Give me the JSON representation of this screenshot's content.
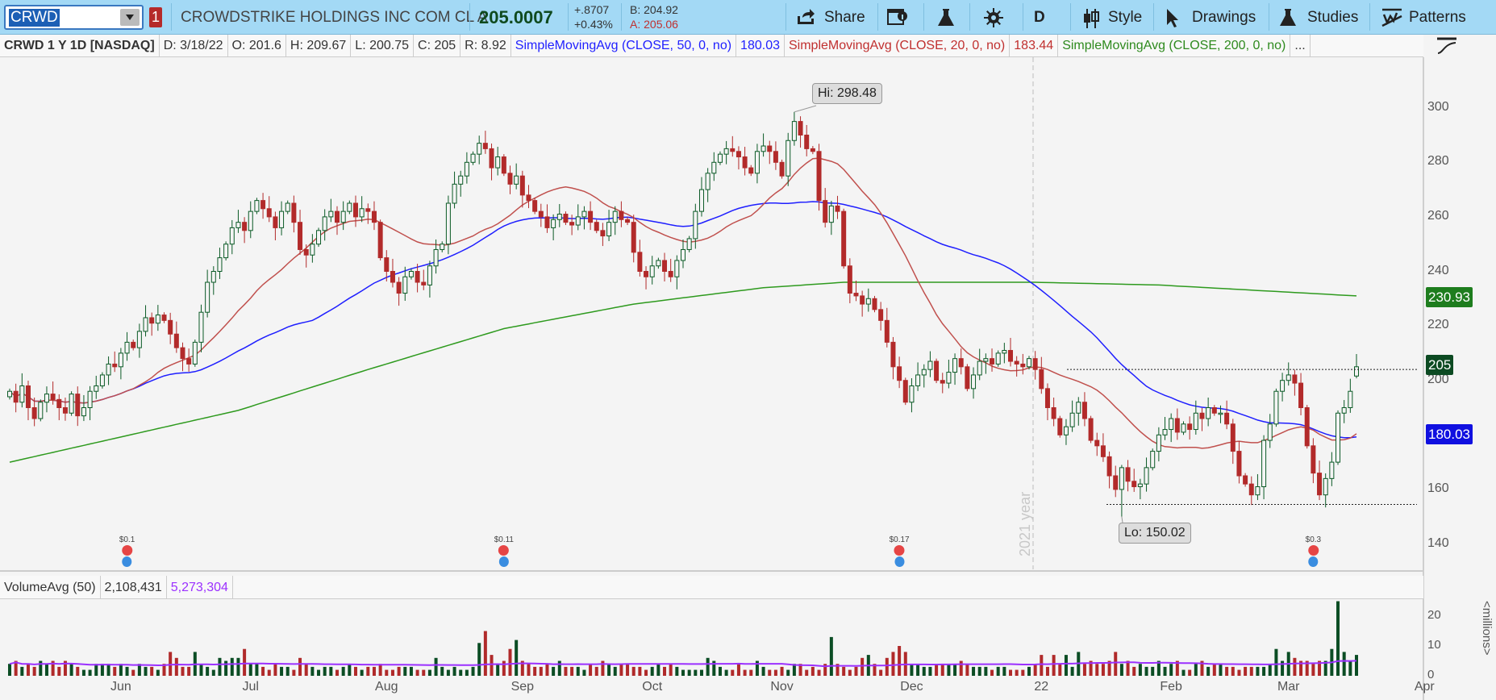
{
  "toolbar": {
    "symbol": "CRWD",
    "link_badge": "1",
    "company": "CROWDSTRIKE HOLDINGS INC COM CL A",
    "last": "205.0007",
    "change": "+.8707",
    "change_pct": "+0.43%",
    "bid": "B: 204.92",
    "ask": "A: 205.06",
    "share": "Share",
    "period": "D",
    "style": "Style",
    "drawings": "Drawings",
    "studies": "Studies",
    "patterns": "Patterns"
  },
  "legend": {
    "title": "CRWD 1 Y 1D [NASDAQ]",
    "date": "D: 3/18/22",
    "open": "O: 201.6",
    "high": "H: 209.67",
    "low": "L: 200.75",
    "close": "C: 205",
    "range": "R: 8.92",
    "sma50_label": "SimpleMovingAvg (CLOSE, 50, 0, no)",
    "sma50_value": "180.03",
    "sma20_label": "SimpleMovingAvg (CLOSE, 20, 0, no)",
    "sma20_value": "183.44",
    "sma200_label": "SimpleMovingAvg (CLOSE, 200, 0, no)",
    "more": "..."
  },
  "volume": {
    "title": "VolumeAvg (50)",
    "value": "2,108,431",
    "avg": "5,273,304",
    "unit_label": "<millions>"
  },
  "annotations": {
    "hi": "Hi: 298.48",
    "lo": "Lo: 150.02",
    "year_marker": "2021 year",
    "resistance": 204,
    "support": 154.5
  },
  "badges": {
    "sma200": "230.93",
    "last": "205",
    "sma50": "180.03"
  },
  "events": [
    {
      "label": "$0.1",
      "index": 19
    },
    {
      "label": "$0.11",
      "index": 80
    },
    {
      "label": "$0.17",
      "index": 144
    },
    {
      "label": "$0.3",
      "index": 211
    }
  ],
  "colors": {
    "up": "#0b5a26",
    "down": "#b22a2a",
    "sma20": "#c0504d",
    "sma50": "#1f1fff",
    "sma200": "#2e9a1e",
    "volavg": "#9b30ff",
    "sma200_badge": "#1e7d1e",
    "last_badge": "#0c4a22",
    "sma50_badge": "#1010e0"
  },
  "chart_data": {
    "type": "candlestick",
    "title": "CRWD 1 Y 1D [NASDAQ]",
    "ylim": [
      130,
      310
    ],
    "y_ticks": [
      140,
      160,
      180,
      200,
      220,
      240,
      260,
      280,
      300
    ],
    "x_ticks": [
      {
        "label": "Jun",
        "index": 18
      },
      {
        "label": "Jul",
        "index": 39
      },
      {
        "label": "Aug",
        "index": 61
      },
      {
        "label": "Sep",
        "index": 83
      },
      {
        "label": "Oct",
        "index": 104
      },
      {
        "label": "Nov",
        "index": 125
      },
      {
        "label": "Dec",
        "index": 146
      },
      {
        "label": "22",
        "index": 167
      },
      {
        "label": "Feb",
        "index": 188
      },
      {
        "label": "Mar",
        "index": 207
      },
      {
        "label": "Apr",
        "index": 229
      }
    ],
    "last_bar": {
      "open": 201.6,
      "high": 209.67,
      "low": 200.75,
      "close": 205
    },
    "hi": {
      "value": 298.48,
      "index": 127
    },
    "lo": {
      "value": 150.02,
      "index": 180
    },
    "close": [
      196,
      192,
      198,
      190,
      186,
      192,
      195,
      193,
      190,
      188,
      195,
      187,
      190,
      196,
      198,
      202,
      206,
      205,
      210,
      214,
      212,
      218,
      223,
      221,
      224,
      222,
      217,
      212,
      208,
      206,
      214,
      225,
      236,
      240,
      245,
      250,
      256,
      258,
      255,
      262,
      266,
      263,
      260,
      256,
      262,
      265,
      258,
      248,
      246,
      250,
      255,
      260,
      262,
      258,
      262,
      265,
      260,
      263,
      262,
      258,
      245,
      240,
      236,
      232,
      238,
      240,
      236,
      235,
      242,
      248,
      250,
      265,
      272,
      275,
      280,
      283,
      287,
      285,
      278,
      282,
      276,
      272,
      275,
      268,
      266,
      262,
      260,
      256,
      259,
      261,
      258,
      257,
      260,
      262,
      258,
      255,
      253,
      258,
      262,
      259,
      258,
      247,
      240,
      238,
      242,
      244,
      240,
      238,
      244,
      248,
      252,
      262,
      270,
      276,
      280,
      283,
      285,
      284,
      282,
      278,
      276,
      284,
      286,
      284,
      280,
      275,
      288,
      295,
      290,
      285,
      284,
      266,
      258,
      264,
      262,
      242,
      232,
      231,
      228,
      230,
      226,
      222,
      214,
      205,
      200,
      192,
      198,
      202,
      204,
      207,
      200,
      199,
      203,
      208,
      205,
      197,
      202,
      207,
      208,
      206,
      210,
      211,
      207,
      206,
      205,
      208,
      204,
      197,
      190,
      186,
      180,
      183,
      188,
      192,
      186,
      178,
      176,
      172,
      165,
      160,
      168,
      163,
      161,
      162,
      168,
      174,
      180,
      182,
      186,
      181,
      184,
      182,
      188,
      186,
      190,
      188,
      188,
      184,
      174,
      165,
      162,
      158,
      161,
      178,
      184,
      196,
      200,
      202,
      199,
      190,
      176,
      166,
      158,
      164,
      170,
      188,
      190,
      196,
      205
    ],
    "volume_millions": [
      4,
      5,
      3,
      4,
      3,
      5,
      4,
      5,
      3,
      5,
      4,
      3,
      2,
      2,
      4,
      4,
      4,
      3,
      4,
      3,
      2,
      4,
      3,
      3,
      2,
      4,
      8,
      6,
      3,
      3,
      8,
      4,
      3,
      2,
      6,
      5,
      6,
      6,
      9,
      4,
      4,
      3,
      2,
      4,
      3,
      3,
      2,
      6,
      4,
      3,
      2,
      3,
      3,
      2,
      3,
      4,
      3,
      2,
      3,
      3,
      4,
      2,
      2,
      3,
      3,
      3,
      2,
      2,
      2,
      6,
      3,
      2,
      3,
      2,
      2,
      3,
      11,
      15,
      7,
      4,
      5,
      9,
      12,
      5,
      4,
      3,
      3,
      4,
      3,
      5,
      3,
      3,
      3,
      2,
      4,
      3,
      5,
      4,
      3,
      4,
      4,
      3,
      3,
      2,
      3,
      4,
      3,
      4,
      3,
      2,
      2,
      2,
      2,
      6,
      5,
      3,
      2,
      2,
      4,
      2,
      2,
      5,
      3,
      2,
      2,
      3,
      2,
      4,
      4,
      2,
      3,
      2,
      4,
      13,
      4,
      3,
      2,
      3,
      6,
      7,
      4,
      2,
      6,
      8,
      10,
      8,
      4,
      4,
      3,
      3,
      4,
      4,
      4,
      4,
      5,
      4,
      3,
      3,
      3,
      2,
      3,
      3,
      2,
      2,
      2,
      3,
      4,
      7,
      3,
      7,
      4,
      7,
      3,
      8,
      4,
      5,
      4,
      4,
      5,
      8,
      4,
      5,
      3,
      4,
      3,
      3,
      5,
      3,
      4,
      5,
      2,
      2,
      4,
      5,
      3,
      4,
      4,
      3,
      3,
      2,
      3,
      3,
      3,
      3,
      4,
      9,
      5,
      8,
      6,
      5,
      5,
      4,
      5,
      5,
      9,
      25,
      8,
      5,
      7
    ],
    "volume_ticks": [
      0,
      10,
      20
    ],
    "sma200_anchors": [
      [
        0,
        170
      ],
      [
        37,
        189
      ],
      [
        58,
        204
      ],
      [
        80,
        219
      ],
      [
        101,
        228
      ],
      [
        122,
        234
      ],
      [
        135,
        236
      ],
      [
        166,
        236
      ],
      [
        186,
        235
      ],
      [
        218,
        231
      ]
    ]
  }
}
